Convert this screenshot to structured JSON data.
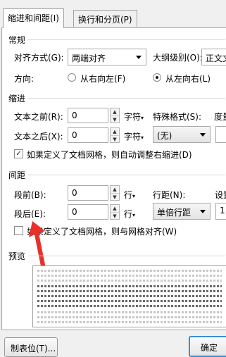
{
  "tabs": [
    {
      "label": "缩进和间距(I)",
      "active": true
    },
    {
      "label": "换行和分页(P)",
      "active": false
    }
  ],
  "general": {
    "heading": "常规",
    "alignment_label": "对齐方式(G):",
    "alignment_value": "两端对齐",
    "outline_label": "大纲级别(O):",
    "outline_value": "正文文本",
    "direction_label": "方向:",
    "direction_options": [
      {
        "label": "从右向左(F)",
        "selected": false
      },
      {
        "label": "从左向右(L)",
        "selected": true
      }
    ]
  },
  "indent": {
    "heading": "缩进",
    "before_label": "文本之前(R):",
    "before_value": "0",
    "before_unit": "字符",
    "after_label": "文本之后(X):",
    "after_value": "0",
    "after_unit": "字符",
    "special_label": "特殊格式(S):",
    "special_value": "(无)",
    "degree_label": "度量",
    "auto_adjust_label": "如果定义了文档网格，则自动调整右缩进(D)",
    "auto_adjust_checked": true
  },
  "spacing": {
    "heading": "间距",
    "before_label": "段前(B):",
    "before_value": "0",
    "before_unit": "行",
    "after_label": "段后(E):",
    "after_value": "0",
    "after_unit": "行",
    "line_label": "行距(N):",
    "line_value": "单倍行距",
    "setting_label": "设置",
    "setting_value": "1",
    "snap_grid_label": "如果定义了文档网格，则与网格对齐(W)",
    "snap_grid_checked": false
  },
  "preview": {
    "heading": "预览"
  },
  "buttons": {
    "tabs_label": "制表位(T)...",
    "ok_label": "确定"
  },
  "colors": {
    "annotation_arrow": "#e8312a",
    "ok_border": "#3a8fd6"
  }
}
